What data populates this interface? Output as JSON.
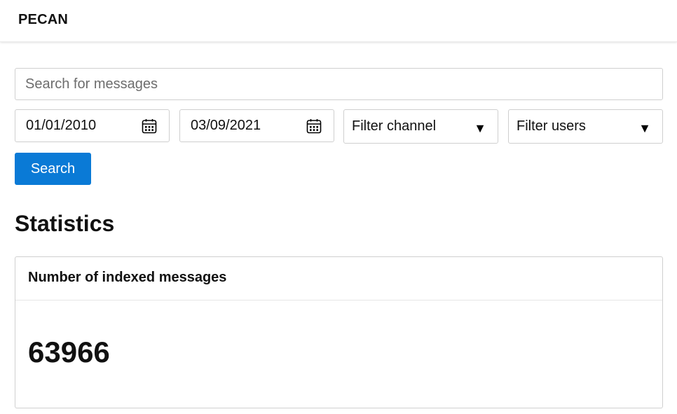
{
  "header": {
    "brand": "PECAN"
  },
  "search": {
    "placeholder": "Search for messages",
    "value": ""
  },
  "filters": {
    "start_date": "01/01/2010",
    "end_date": "03/09/2021",
    "channel_label": "Filter channel",
    "users_label": "Filter users",
    "calendar_icon": "calendar-icon",
    "dropdown_icon": "caret-down-icon"
  },
  "actions": {
    "search_label": "Search"
  },
  "statistics": {
    "title": "Statistics",
    "card_title": "Number of indexed messages",
    "card_value": "63966"
  },
  "colors": {
    "primary_button": "#0a7ad6",
    "border": "#cfcfcf",
    "text": "#111111"
  }
}
